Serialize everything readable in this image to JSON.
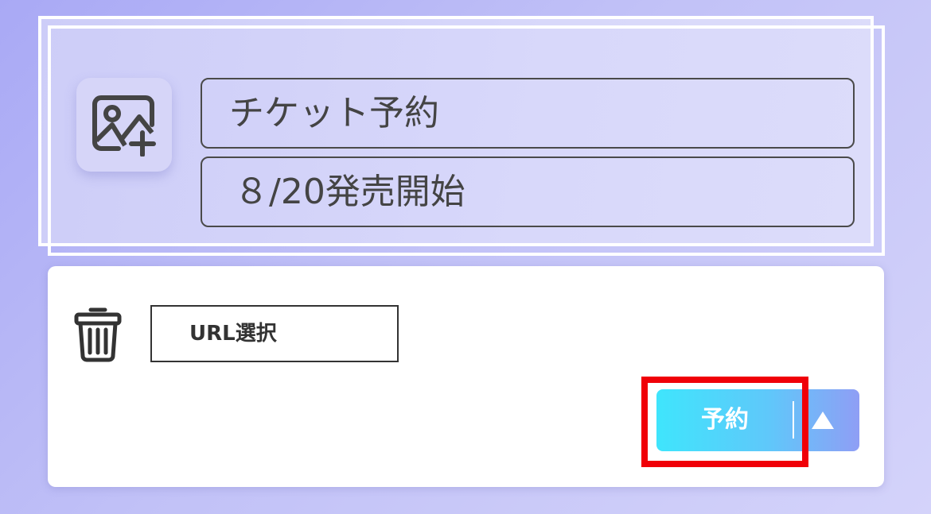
{
  "header": {
    "title": "チケット予約",
    "subtitle": "８/20発売開始",
    "image_icon": "add-image-icon"
  },
  "actions": {
    "delete_icon": "trash-icon",
    "url_button_label": "URL選択",
    "reserve_label": "予約",
    "toggle_icon": "triangle-up-icon"
  },
  "colors": {
    "background": "#b3b3f6",
    "card": "#ffffff",
    "button_gradient_start": "#3fe5fc",
    "button_gradient_end": "#8f9ef5",
    "highlight": "#f00008",
    "text": "#444444"
  }
}
